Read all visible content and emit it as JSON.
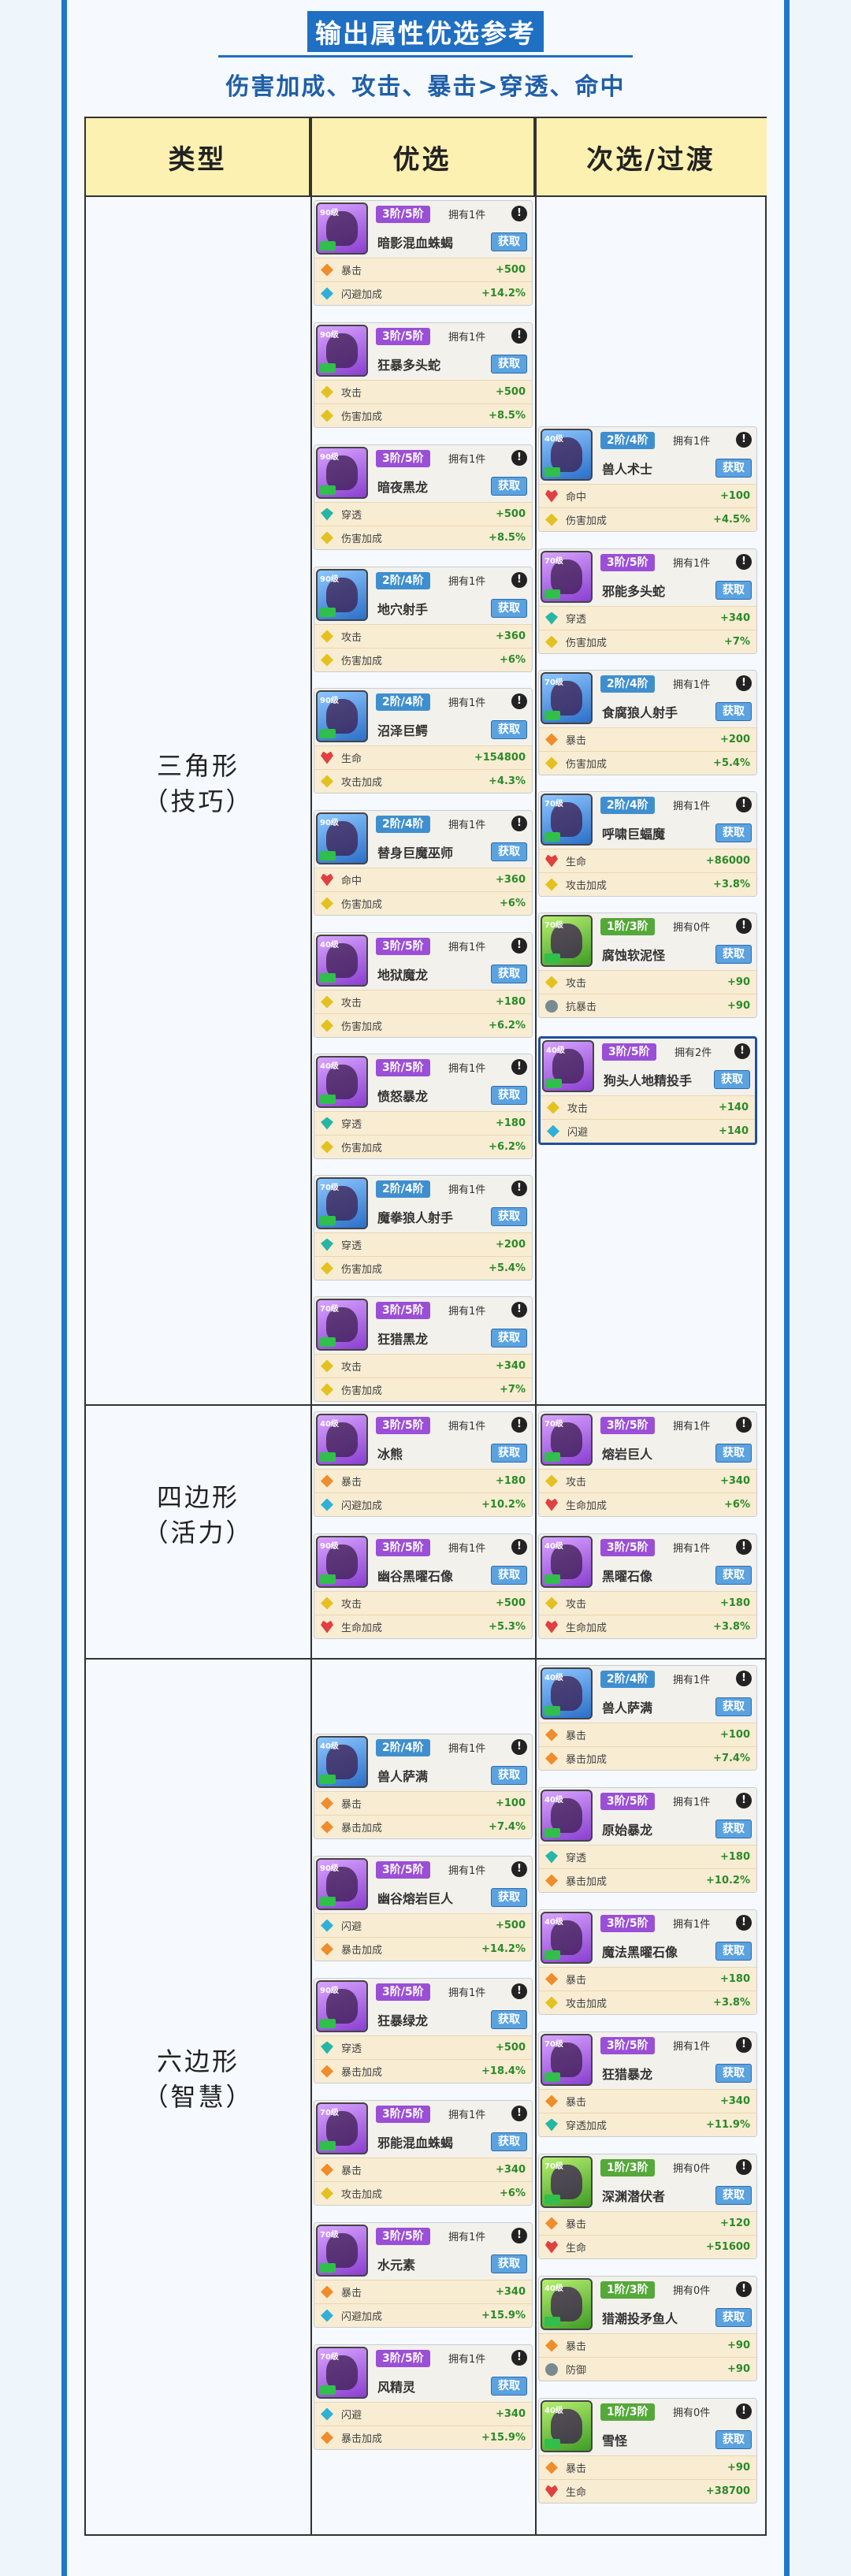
{
  "header": {
    "title": "输出属性优选参考",
    "subtitle": "伤害加成、攻击、暴击>穿透、命中"
  },
  "table": {
    "columns": [
      "类型",
      "优选",
      "次选/过渡"
    ],
    "rows": [
      {
        "type_line1": "三角形",
        "type_line2": "（技巧）"
      },
      {
        "type_line1": "四边形",
        "type_line2": "（活力）"
      },
      {
        "type_line1": "六边形",
        "type_line2": "（智慧）"
      }
    ]
  },
  "cards": [
    {
      "id": "c1",
      "name": "暗影混血蛛蝎",
      "rank": "3阶/5阶",
      "rank_color": "purple",
      "owned": "拥有1件",
      "portrait": "purple",
      "level": "90级",
      "get": "获取",
      "stats": [
        {
          "icon": "orange",
          "label": "暴击",
          "value": "+500"
        },
        {
          "icon": "cyan",
          "label": "闪避加成",
          "value": "+14.2%"
        }
      ]
    },
    {
      "id": "c2",
      "name": "狂暴多头蛇",
      "rank": "3阶/5阶",
      "rank_color": "purple",
      "owned": "拥有1件",
      "portrait": "purple",
      "level": "90级",
      "get": "获取",
      "stats": [
        {
          "icon": "yellow",
          "label": "攻击",
          "value": "+500"
        },
        {
          "icon": "yellow",
          "label": "伤害加成",
          "value": "+8.5%"
        }
      ]
    },
    {
      "id": "c3",
      "name": "暗夜黑龙",
      "rank": "3阶/5阶",
      "rank_color": "purple",
      "owned": "拥有1件",
      "portrait": "purple",
      "level": "90级",
      "get": "获取",
      "stats": [
        {
          "icon": "teal",
          "label": "穿透",
          "value": "+500"
        },
        {
          "icon": "yellow",
          "label": "伤害加成",
          "value": "+8.5%"
        }
      ]
    },
    {
      "id": "c4",
      "name": "地穴射手",
      "rank": "2阶/4阶",
      "rank_color": "blue",
      "owned": "拥有1件",
      "portrait": "blue",
      "level": "90级",
      "get": "获取",
      "stats": [
        {
          "icon": "yellow",
          "label": "攻击",
          "value": "+360"
        },
        {
          "icon": "yellow",
          "label": "伤害加成",
          "value": "+6%"
        }
      ]
    },
    {
      "id": "c5",
      "name": "沼泽巨鳄",
      "rank": "2阶/4阶",
      "rank_color": "blue",
      "owned": "拥有1件",
      "portrait": "blue",
      "level": "90级",
      "get": "获取",
      "stats": [
        {
          "icon": "red",
          "label": "生命",
          "value": "+154800"
        },
        {
          "icon": "yellow",
          "label": "攻击加成",
          "value": "+4.3%"
        }
      ]
    },
    {
      "id": "c6",
      "name": "替身巨魔巫师",
      "rank": "2阶/4阶",
      "rank_color": "blue",
      "owned": "拥有1件",
      "portrait": "blue",
      "level": "90级",
      "get": "获取",
      "stats": [
        {
          "icon": "red",
          "label": "命中",
          "value": "+360"
        },
        {
          "icon": "yellow",
          "label": "伤害加成",
          "value": "+6%"
        }
      ]
    },
    {
      "id": "c7",
      "name": "地狱魔龙",
      "rank": "3阶/5阶",
      "rank_color": "purple",
      "owned": "拥有1件",
      "portrait": "purple",
      "level": "40级",
      "get": "获取",
      "stats": [
        {
          "icon": "yellow",
          "label": "攻击",
          "value": "+180"
        },
        {
          "icon": "yellow",
          "label": "伤害加成",
          "value": "+6.2%"
        }
      ]
    },
    {
      "id": "c8",
      "name": "愤怒暴龙",
      "rank": "3阶/5阶",
      "rank_color": "purple",
      "owned": "拥有1件",
      "portrait": "purple",
      "level": "40级",
      "get": "获取",
      "stats": [
        {
          "icon": "teal",
          "label": "穿透",
          "value": "+180"
        },
        {
          "icon": "yellow",
          "label": "伤害加成",
          "value": "+6.2%"
        }
      ]
    },
    {
      "id": "c9",
      "name": "魔拳狼人射手",
      "rank": "2阶/4阶",
      "rank_color": "blue",
      "owned": "拥有1件",
      "portrait": "blue",
      "level": "70级",
      "get": "获取",
      "stats": [
        {
          "icon": "teal",
          "label": "穿透",
          "value": "+200"
        },
        {
          "icon": "yellow",
          "label": "伤害加成",
          "value": "+5.4%"
        }
      ]
    },
    {
      "id": "c10",
      "name": "狂猎黑龙",
      "rank": "3阶/5阶",
      "rank_color": "purple",
      "owned": "拥有1件",
      "portrait": "purple",
      "level": "70级",
      "get": "获取",
      "stats": [
        {
          "icon": "yellow",
          "label": "攻击",
          "value": "+340"
        },
        {
          "icon": "yellow",
          "label": "伤害加成",
          "value": "+7%"
        }
      ]
    },
    {
      "id": "d1",
      "name": "兽人术士",
      "rank": "2阶/4阶",
      "rank_color": "blue",
      "owned": "拥有1件",
      "portrait": "blue",
      "level": "40级",
      "get": "获取",
      "stats": [
        {
          "icon": "red",
          "label": "命中",
          "value": "+100"
        },
        {
          "icon": "yellow",
          "label": "伤害加成",
          "value": "+4.5%"
        }
      ]
    },
    {
      "id": "d2",
      "name": "邪能多头蛇",
      "rank": "3阶/5阶",
      "rank_color": "purple",
      "owned": "拥有1件",
      "portrait": "purple",
      "level": "70级",
      "get": "获取",
      "stats": [
        {
          "icon": "teal",
          "label": "穿透",
          "value": "+340"
        },
        {
          "icon": "yellow",
          "label": "伤害加成",
          "value": "+7%"
        }
      ]
    },
    {
      "id": "d3",
      "name": "食腐狼人射手",
      "rank": "2阶/4阶",
      "rank_color": "blue",
      "owned": "拥有1件",
      "portrait": "blue",
      "level": "70级",
      "get": "获取",
      "stats": [
        {
          "icon": "orange",
          "label": "暴击",
          "value": "+200"
        },
        {
          "icon": "yellow",
          "label": "伤害加成",
          "value": "+5.4%"
        }
      ]
    },
    {
      "id": "d4",
      "name": "呼啸巨蝠魔",
      "rank": "2阶/4阶",
      "rank_color": "blue",
      "owned": "拥有1件",
      "portrait": "blue",
      "level": "70级",
      "get": "获取",
      "stats": [
        {
          "icon": "red",
          "label": "生命",
          "value": "+86000"
        },
        {
          "icon": "yellow",
          "label": "攻击加成",
          "value": "+3.8%"
        }
      ]
    },
    {
      "id": "d5",
      "name": "腐蚀软泥怪",
      "rank": "1阶/3阶",
      "rank_color": "green",
      "owned": "拥有0件",
      "portrait": "green",
      "level": "70级",
      "get": "获取",
      "stats": [
        {
          "icon": "yellow",
          "label": "攻击",
          "value": "+90"
        },
        {
          "icon": "gray",
          "label": "抗暴击",
          "value": "+90"
        }
      ]
    },
    {
      "id": "d6",
      "name": "狗头人地精投手",
      "rank": "3阶/5阶",
      "rank_color": "purple",
      "owned": "拥有2件",
      "portrait": "purple",
      "level": "40级",
      "get": "获取",
      "stats": [
        {
          "icon": "yellow",
          "label": "攻击",
          "value": "+140"
        },
        {
          "icon": "cyan",
          "label": "闪避",
          "value": "+140"
        }
      ]
    },
    {
      "id": "c11",
      "name": "冰熊",
      "rank": "3阶/5阶",
      "rank_color": "purple",
      "owned": "拥有1件",
      "portrait": "purple",
      "level": "40级",
      "get": "获取",
      "stats": [
        {
          "icon": "orange",
          "label": "暴击",
          "value": "+180"
        },
        {
          "icon": "cyan",
          "label": "闪避加成",
          "value": "+10.2%"
        }
      ]
    },
    {
      "id": "c12",
      "name": "幽谷黑曜石像",
      "rank": "3阶/5阶",
      "rank_color": "purple",
      "owned": "拥有1件",
      "portrait": "purple",
      "level": "90级",
      "get": "获取",
      "stats": [
        {
          "icon": "yellow",
          "label": "攻击",
          "value": "+500"
        },
        {
          "icon": "red",
          "label": "生命加成",
          "value": "+5.3%"
        }
      ]
    },
    {
      "id": "d7",
      "name": "熔岩巨人",
      "rank": "3阶/5阶",
      "rank_color": "purple",
      "owned": "拥有1件",
      "portrait": "purple",
      "level": "70级",
      "get": "获取",
      "stats": [
        {
          "icon": "yellow",
          "label": "攻击",
          "value": "+340"
        },
        {
          "icon": "red",
          "label": "生命加成",
          "value": "+6%"
        }
      ]
    },
    {
      "id": "d8",
      "name": "黑曜石像",
      "rank": "3阶/5阶",
      "rank_color": "purple",
      "owned": "拥有1件",
      "portrait": "purple",
      "level": "40级",
      "get": "获取",
      "stats": [
        {
          "icon": "yellow",
          "label": "攻击",
          "value": "+180"
        },
        {
          "icon": "red",
          "label": "生命加成",
          "value": "+3.8%"
        }
      ]
    },
    {
      "id": "c13",
      "name": "兽人萨满",
      "rank": "2阶/4阶",
      "rank_color": "blue",
      "owned": "拥有1件",
      "portrait": "blue",
      "level": "40级",
      "get": "获取",
      "stats": [
        {
          "icon": "orange",
          "label": "暴击",
          "value": "+100"
        },
        {
          "icon": "orange",
          "label": "暴击加成",
          "value": "+7.4%"
        }
      ]
    },
    {
      "id": "c14",
      "name": "幽谷熔岩巨人",
      "rank": "3阶/5阶",
      "rank_color": "purple",
      "owned": "拥有1件",
      "portrait": "purple",
      "level": "90级",
      "get": "获取",
      "stats": [
        {
          "icon": "cyan",
          "label": "闪避",
          "value": "+500"
        },
        {
          "icon": "orange",
          "label": "暴击加成",
          "value": "+14.2%"
        }
      ]
    },
    {
      "id": "c15",
      "name": "狂暴绿龙",
      "rank": "3阶/5阶",
      "rank_color": "purple",
      "owned": "拥有1件",
      "portrait": "purple",
      "level": "90级",
      "get": "获取",
      "stats": [
        {
          "icon": "teal",
          "label": "穿透",
          "value": "+500"
        },
        {
          "icon": "orange",
          "label": "暴击加成",
          "value": "+18.4%"
        }
      ]
    },
    {
      "id": "c16",
      "name": "邪能混血蛛蝎",
      "rank": "3阶/5阶",
      "rank_color": "purple",
      "owned": "拥有1件",
      "portrait": "purple",
      "level": "70级",
      "get": "获取",
      "stats": [
        {
          "icon": "orange",
          "label": "暴击",
          "value": "+340"
        },
        {
          "icon": "yellow",
          "label": "攻击加成",
          "value": "+6%"
        }
      ]
    },
    {
      "id": "c17",
      "name": "水元素",
      "rank": "3阶/5阶",
      "rank_color": "purple",
      "owned": "拥有1件",
      "portrait": "purple",
      "level": "70级",
      "get": "获取",
      "stats": [
        {
          "icon": "orange",
          "label": "暴击",
          "value": "+340"
        },
        {
          "icon": "cyan",
          "label": "闪避加成",
          "value": "+15.9%"
        }
      ]
    },
    {
      "id": "c18",
      "name": "风精灵",
      "rank": "3阶/5阶",
      "rank_color": "purple",
      "owned": "拥有1件",
      "portrait": "purple",
      "level": "70级",
      "get": "获取",
      "stats": [
        {
          "icon": "cyan",
          "label": "闪避",
          "value": "+340"
        },
        {
          "icon": "orange",
          "label": "暴击加成",
          "value": "+15.9%"
        }
      ]
    },
    {
      "id": "d9",
      "name": "兽人萨满",
      "rank": "2阶/4阶",
      "rank_color": "blue",
      "owned": "拥有1件",
      "portrait": "blue",
      "level": "40级",
      "get": "获取",
      "stats": [
        {
          "icon": "orange",
          "label": "暴击",
          "value": "+100"
        },
        {
          "icon": "orange",
          "label": "暴击加成",
          "value": "+7.4%"
        }
      ]
    },
    {
      "id": "d10",
      "name": "原始暴龙",
      "rank": "3阶/5阶",
      "rank_color": "purple",
      "owned": "拥有1件",
      "portrait": "purple",
      "level": "40级",
      "get": "获取",
      "stats": [
        {
          "icon": "teal",
          "label": "穿透",
          "value": "+180"
        },
        {
          "icon": "orange",
          "label": "暴击加成",
          "value": "+10.2%"
        }
      ]
    },
    {
      "id": "d11",
      "name": "魔法黑曜石像",
      "rank": "3阶/5阶",
      "rank_color": "purple",
      "owned": "拥有1件",
      "portrait": "purple",
      "level": "40级",
      "get": "获取",
      "stats": [
        {
          "icon": "orange",
          "label": "暴击",
          "value": "+180"
        },
        {
          "icon": "yellow",
          "label": "攻击加成",
          "value": "+3.8%"
        }
      ]
    },
    {
      "id": "d12",
      "name": "狂猎暴龙",
      "rank": "3阶/5阶",
      "rank_color": "purple",
      "owned": "拥有1件",
      "portrait": "purple",
      "level": "70级",
      "get": "获取",
      "stats": [
        {
          "icon": "orange",
          "label": "暴击",
          "value": "+340"
        },
        {
          "icon": "teal",
          "label": "穿透加成",
          "value": "+11.9%"
        }
      ]
    },
    {
      "id": "d13",
      "name": "深渊潜伏者",
      "rank": "1阶/3阶",
      "rank_color": "green",
      "owned": "拥有0件",
      "portrait": "green",
      "level": "70级",
      "get": "获取",
      "stats": [
        {
          "icon": "orange",
          "label": "暴击",
          "value": "+120"
        },
        {
          "icon": "red",
          "label": "生命",
          "value": "+51600"
        }
      ]
    },
    {
      "id": "d14",
      "name": "猎潮投矛鱼人",
      "rank": "1阶/3阶",
      "rank_color": "green",
      "owned": "拥有0件",
      "portrait": "green",
      "level": "40级",
      "get": "获取",
      "stats": [
        {
          "icon": "orange",
          "label": "暴击",
          "value": "+90"
        },
        {
          "icon": "gray",
          "label": "防御",
          "value": "+90"
        }
      ]
    },
    {
      "id": "d15",
      "name": "雪怪",
      "rank": "1阶/3阶",
      "rank_color": "green",
      "owned": "拥有0件",
      "portrait": "green",
      "level": "40级",
      "get": "获取",
      "stats": [
        {
          "icon": "orange",
          "label": "暴击",
          "value": "+90"
        },
        {
          "icon": "red",
          "label": "生命",
          "value": "+38700"
        }
      ]
    }
  ]
}
